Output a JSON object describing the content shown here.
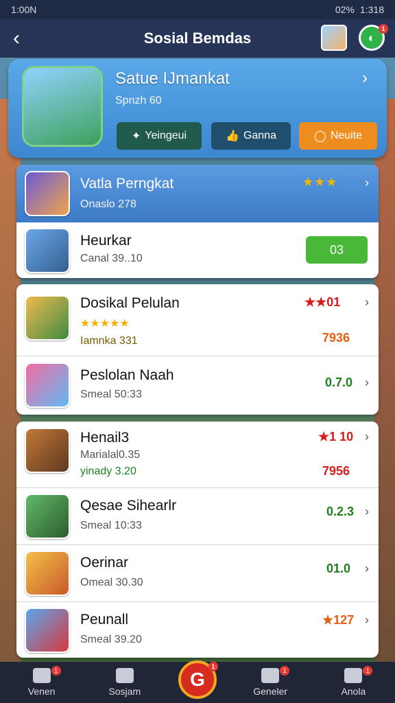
{
  "status": {
    "time_left": "1:00N",
    "battery": "02%",
    "time_right": "1:318"
  },
  "header": {
    "title": "Sosial Bemdas"
  },
  "hero": {
    "name": "Satue IJmankat",
    "subtitle": "Spnzh 60",
    "buttons": [
      "Yeingeui",
      "Ganna",
      "Neuite"
    ]
  },
  "featured": {
    "name": "Vatla Perngkat",
    "subtitle": "Onaslo 278",
    "stars": "★★★"
  },
  "list": [
    {
      "name": "Heurkar",
      "subtitle": "Canal 39..10",
      "right": "03"
    },
    {
      "name": "Dosikal Pelulan",
      "subtitle": "★★★★★",
      "subtitle2": "Iamnka 331",
      "right": "★★01",
      "badge": "7936"
    },
    {
      "name": "Peslolan Naah",
      "subtitle": "Smeal 50:33",
      "right": "0.7.0"
    },
    {
      "name": "Henail3",
      "subtitle": "Marialal0.35",
      "subtitle2": "yinady 3.20",
      "right": "★1 10",
      "badge": "7956"
    },
    {
      "name": "Qesae Sihearlr",
      "subtitle": "Smeal 10:33",
      "right": "0.2.3"
    },
    {
      "name": "Oerinar",
      "subtitle": "Omeal 30.30",
      "right": "01.0"
    },
    {
      "name": "Peunall",
      "subtitle": "Smeal 39.20",
      "right": "★127"
    }
  ],
  "nav": {
    "items": [
      "Venen",
      "Sosjam",
      "Geneler",
      "Anola"
    ]
  },
  "center_button": "G"
}
